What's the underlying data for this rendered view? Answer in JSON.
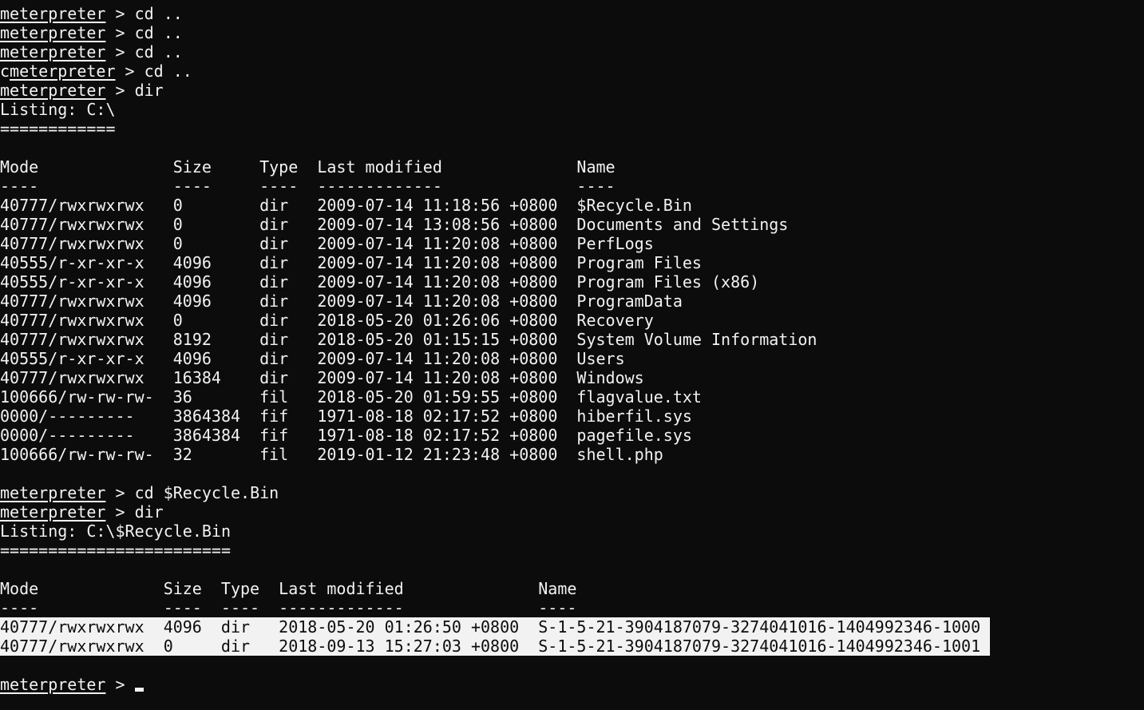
{
  "prompt": "meterpreter",
  "prompt_sep": " > ",
  "history1": [
    {
      "prefix": "",
      "cmd": "cd .."
    },
    {
      "prefix": "",
      "cmd": "cd .."
    },
    {
      "prefix": "",
      "cmd": "cd .."
    },
    {
      "prefix": "c",
      "cmd": "cd .."
    },
    {
      "prefix": "",
      "cmd": "dir"
    }
  ],
  "listing1": {
    "title": "Listing: C:\\",
    "rule": "============",
    "headers": [
      "Mode",
      "Size",
      "Type",
      "Last modified",
      "Name"
    ],
    "dashes": [
      "----",
      "----",
      "----",
      "-------------",
      "----"
    ],
    "rows": [
      [
        "40777/rwxrwxrwx",
        "0",
        "dir",
        "2009-07-14 11:18:56 +0800",
        "$Recycle.Bin"
      ],
      [
        "40777/rwxrwxrwx",
        "0",
        "dir",
        "2009-07-14 13:08:56 +0800",
        "Documents and Settings"
      ],
      [
        "40777/rwxrwxrwx",
        "0",
        "dir",
        "2009-07-14 11:20:08 +0800",
        "PerfLogs"
      ],
      [
        "40555/r-xr-xr-x",
        "4096",
        "dir",
        "2009-07-14 11:20:08 +0800",
        "Program Files"
      ],
      [
        "40555/r-xr-xr-x",
        "4096",
        "dir",
        "2009-07-14 11:20:08 +0800",
        "Program Files (x86)"
      ],
      [
        "40777/rwxrwxrwx",
        "4096",
        "dir",
        "2009-07-14 11:20:08 +0800",
        "ProgramData"
      ],
      [
        "40777/rwxrwxrwx",
        "0",
        "dir",
        "2018-05-20 01:26:06 +0800",
        "Recovery"
      ],
      [
        "40777/rwxrwxrwx",
        "8192",
        "dir",
        "2018-05-20 01:15:15 +0800",
        "System Volume Information"
      ],
      [
        "40555/r-xr-xr-x",
        "4096",
        "dir",
        "2009-07-14 11:20:08 +0800",
        "Users"
      ],
      [
        "40777/rwxrwxrwx",
        "16384",
        "dir",
        "2009-07-14 11:20:08 +0800",
        "Windows"
      ],
      [
        "100666/rw-rw-rw-",
        "36",
        "fil",
        "2018-05-20 01:59:55 +0800",
        "flagvalue.txt"
      ],
      [
        "0000/---------",
        "3864384",
        "fif",
        "1971-08-18 02:17:52 +0800",
        "hiberfil.sys"
      ],
      [
        "0000/---------",
        "3864384",
        "fif",
        "1971-08-18 02:17:52 +0800",
        "pagefile.sys"
      ],
      [
        "100666/rw-rw-rw-",
        "32",
        "fil",
        "2019-01-12 21:23:48 +0800",
        "shell.php"
      ]
    ]
  },
  "history2": [
    {
      "prefix": "",
      "cmd": "cd $Recycle.Bin"
    },
    {
      "prefix": "",
      "cmd": "dir"
    }
  ],
  "listing2": {
    "title": "Listing: C:\\$Recycle.Bin",
    "rule": "========================",
    "headers": [
      "Mode",
      "Size",
      "Type",
      "Last modified",
      "Name"
    ],
    "dashes": [
      "----",
      "----",
      "----",
      "-------------",
      "----"
    ],
    "rows": [
      [
        "40777/rwxrwxrwx",
        "4096",
        "dir",
        "2018-05-20 01:26:50 +0800",
        "S-1-5-21-3904187079-3274041016-1404992346-1000"
      ],
      [
        "40777/rwxrwxrwx",
        "0",
        "dir",
        "2018-09-13 15:27:03 +0800",
        "S-1-5-21-3904187079-3274041016-1404992346-1001"
      ]
    ],
    "selected_rows": [
      0,
      1
    ]
  },
  "colors": {
    "background": "#0c0c0c",
    "foreground": "#f2f2f2",
    "selection": "#f2f2f2"
  }
}
